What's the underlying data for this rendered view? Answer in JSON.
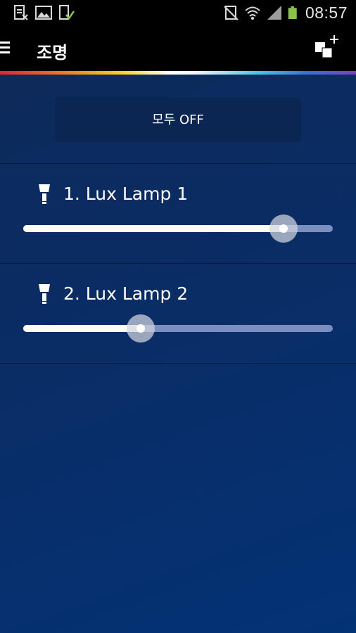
{
  "status_bar": {
    "time": "08:57",
    "icons": [
      "screenshot-icon",
      "gallery-icon",
      "download-done-icon",
      "mute-icon",
      "wifi-icon",
      "signal-icon",
      "battery-icon"
    ]
  },
  "app_bar": {
    "title": "조명",
    "menu_icon": "menu-icon",
    "action_icon": "add-light-icon"
  },
  "main": {
    "all_off_label": "모두 OFF",
    "lamps": [
      {
        "name": "1. Lux Lamp 1",
        "brightness_percent": 84
      },
      {
        "name": "2. Lux Lamp 2",
        "brightness_percent": 38
      }
    ]
  },
  "colors": {
    "background": "#0a2d66",
    "slider_fill": "#fffdf3",
    "slider_track": "#7a8ec0"
  }
}
